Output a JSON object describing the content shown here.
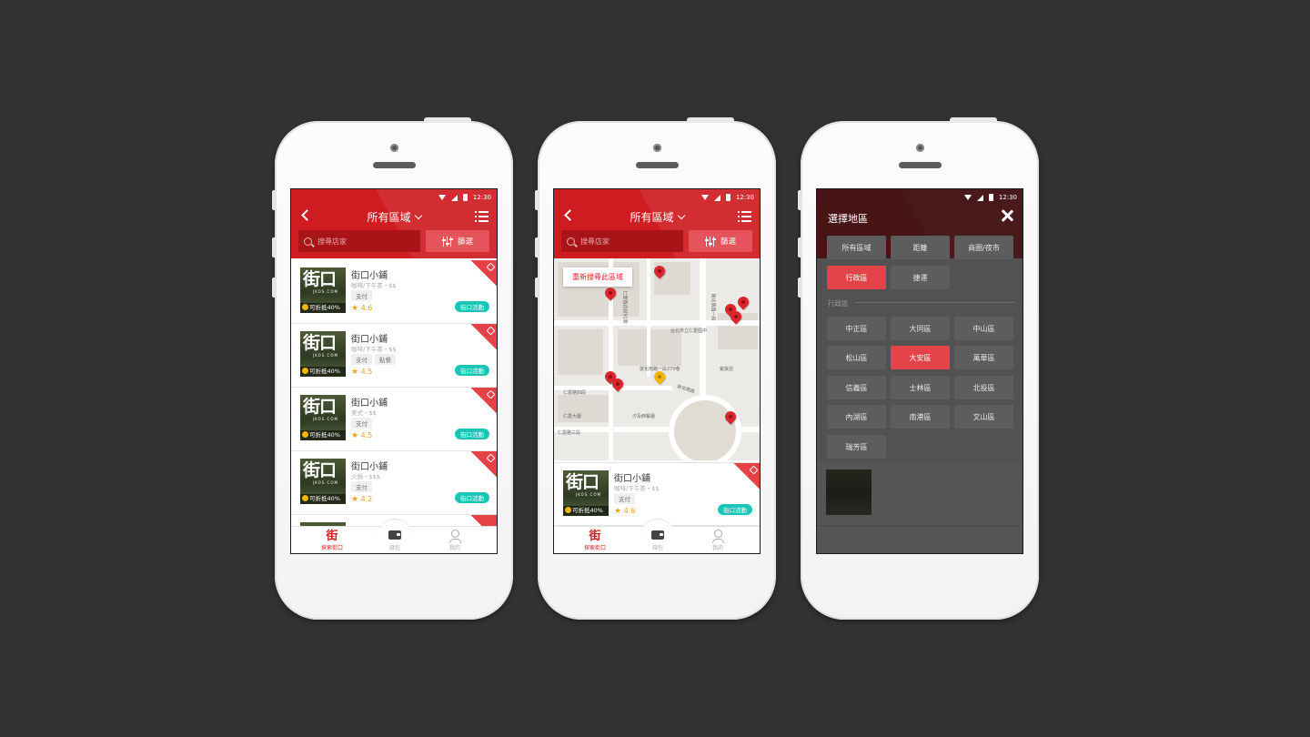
{
  "status_time": "12:30",
  "header_title": "所有區域",
  "search_placeholder": "搜尋店家",
  "filter_label": "篩選",
  "stores": [
    {
      "name": "街口小鋪",
      "category": "咖啡/下午茶・$$",
      "tags": [
        "支付"
      ],
      "rating": "4.6",
      "discount": "可折抵40%",
      "event": "街口活動"
    },
    {
      "name": "街口小鋪",
      "category": "咖啡/下午茶・$$",
      "tags": [
        "支付",
        "點餐"
      ],
      "rating": "4.5",
      "discount": "可折抵40%",
      "event": "街口活動"
    },
    {
      "name": "街口小鋪",
      "category": "美式・$$",
      "tags": [
        "支付"
      ],
      "rating": "4.5",
      "discount": "可折抵40%",
      "event": "街口活動"
    },
    {
      "name": "街口小鋪",
      "category": "火鍋・$$$",
      "tags": [
        "支付"
      ],
      "rating": "4.2",
      "discount": "可折抵40%",
      "event": "街口活動"
    }
  ],
  "thumb_logo": "街口",
  "thumb_url": "JKOS.COM",
  "tabs": [
    {
      "icon": "街",
      "label": "探索街口"
    },
    {
      "icon": "wallet-icon",
      "label": "錢包"
    },
    {
      "icon": "user-icon",
      "label": "我的"
    }
  ],
  "map": {
    "research_label": "重新搜尋此區域",
    "street_labels": [
      "仁愛路四段",
      "仁愛路四段91巷",
      "仁愛路三段",
      "仁愛大廳",
      "敦化南路一段",
      "仁愛路四段",
      "敦化南路",
      "汐及西餐廳",
      "聯合報",
      "復興南路",
      "敦化南路一段270巷",
      "台北市立仁愛國中",
      "中華民國",
      "紫質店"
    ]
  },
  "modal": {
    "title": "選擇地區",
    "top_options": [
      {
        "label": "所有區域",
        "selected": false
      },
      {
        "label": "距離",
        "selected": false
      },
      {
        "label": "商圈/夜市",
        "selected": false
      },
      {
        "label": "行政區",
        "selected": true
      },
      {
        "label": "捷運",
        "selected": false
      }
    ],
    "section_label": "行政區",
    "districts": [
      {
        "label": "中正區",
        "selected": false
      },
      {
        "label": "大同區",
        "selected": false
      },
      {
        "label": "中山區",
        "selected": false
      },
      {
        "label": "松山區",
        "selected": false
      },
      {
        "label": "大安區",
        "selected": true
      },
      {
        "label": "萬華區",
        "selected": false
      },
      {
        "label": "信義區",
        "selected": false
      },
      {
        "label": "士林區",
        "selected": false
      },
      {
        "label": "北投區",
        "selected": false
      },
      {
        "label": "內湖區",
        "selected": false
      },
      {
        "label": "南港區",
        "selected": false
      },
      {
        "label": "文山區",
        "selected": false
      },
      {
        "label": "瑞芳區",
        "selected": false
      }
    ]
  },
  "colors": {
    "brand_red": "#cf1c21",
    "accent_red": "#e5434a",
    "teal": "#19c6b6",
    "star": "#f0a020",
    "background": "#323232"
  }
}
